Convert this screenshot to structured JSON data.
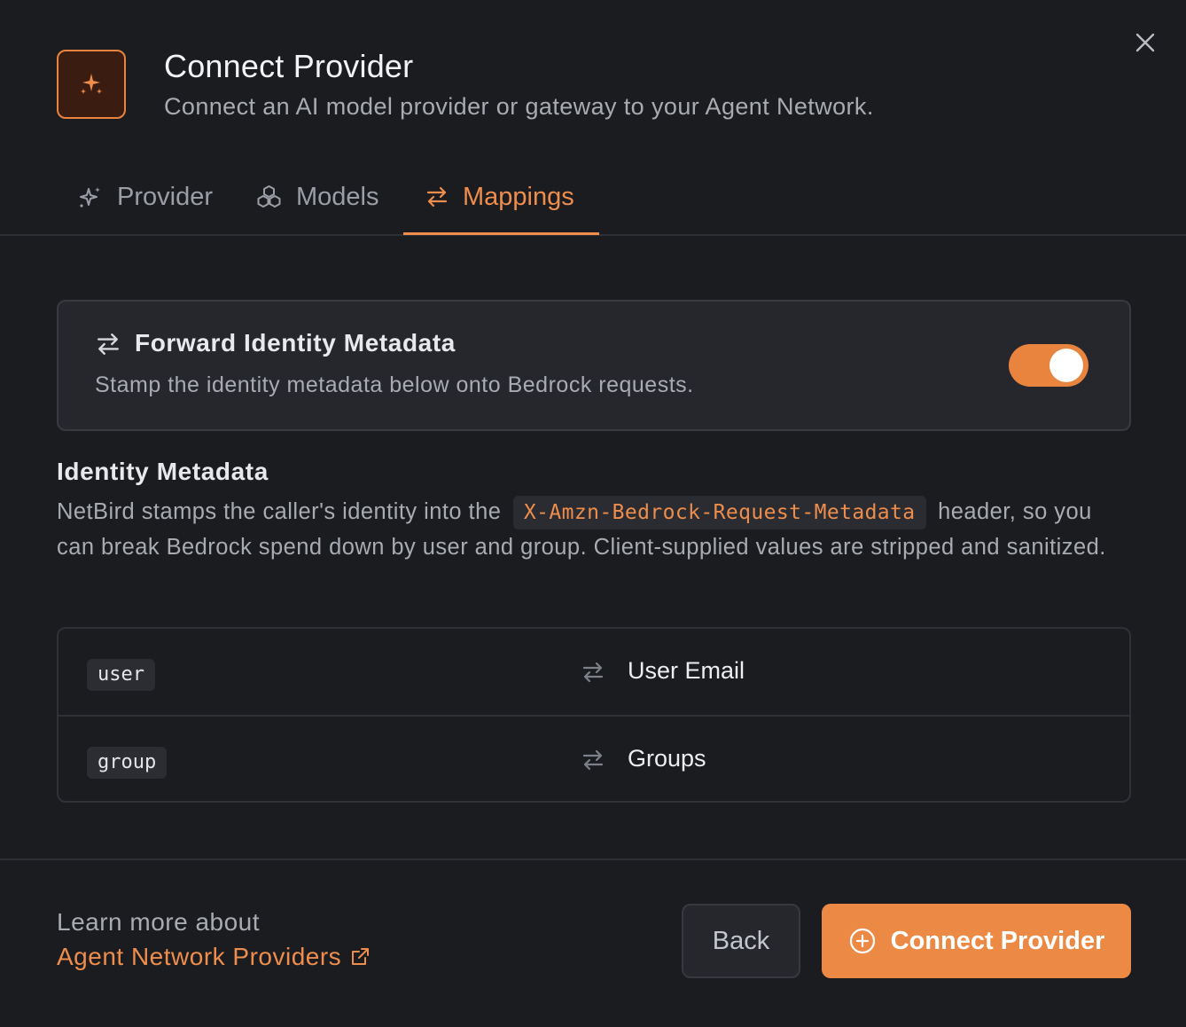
{
  "header": {
    "title": "Connect Provider",
    "subtitle": "Connect an AI model provider or gateway to your Agent Network.",
    "logo_icon": "sparkles-icon",
    "close_icon": "close-icon"
  },
  "tabs": [
    {
      "label": "Provider",
      "icon": "sparkles-outline-icon",
      "active": false
    },
    {
      "label": "Models",
      "icon": "cubes-icon",
      "active": false
    },
    {
      "label": "Mappings",
      "icon": "arrows-left-right-icon",
      "active": true
    }
  ],
  "forward": {
    "title": "Forward Identity Metadata",
    "description": "Stamp the identity metadata below onto Bedrock requests.",
    "enabled": true
  },
  "identity": {
    "title": "Identity Metadata",
    "desc_before": "NetBird stamps the caller's identity into the",
    "header_name": "X-Amzn-Bedrock-Request-Metadata",
    "desc_after": "header, so you can break Bedrock spend down by user and group. Client-supplied values are stripped and sanitized."
  },
  "mappings": [
    {
      "key": "user",
      "value": "User Email"
    },
    {
      "key": "group",
      "value": "Groups"
    }
  ],
  "footer": {
    "learn_text": "Learn more about",
    "learn_link": "Agent Network Providers",
    "back_label": "Back",
    "connect_label": "Connect Provider"
  },
  "colors": {
    "accent": "#ec8a45",
    "background": "#1b1c20",
    "card": "#25272c"
  }
}
